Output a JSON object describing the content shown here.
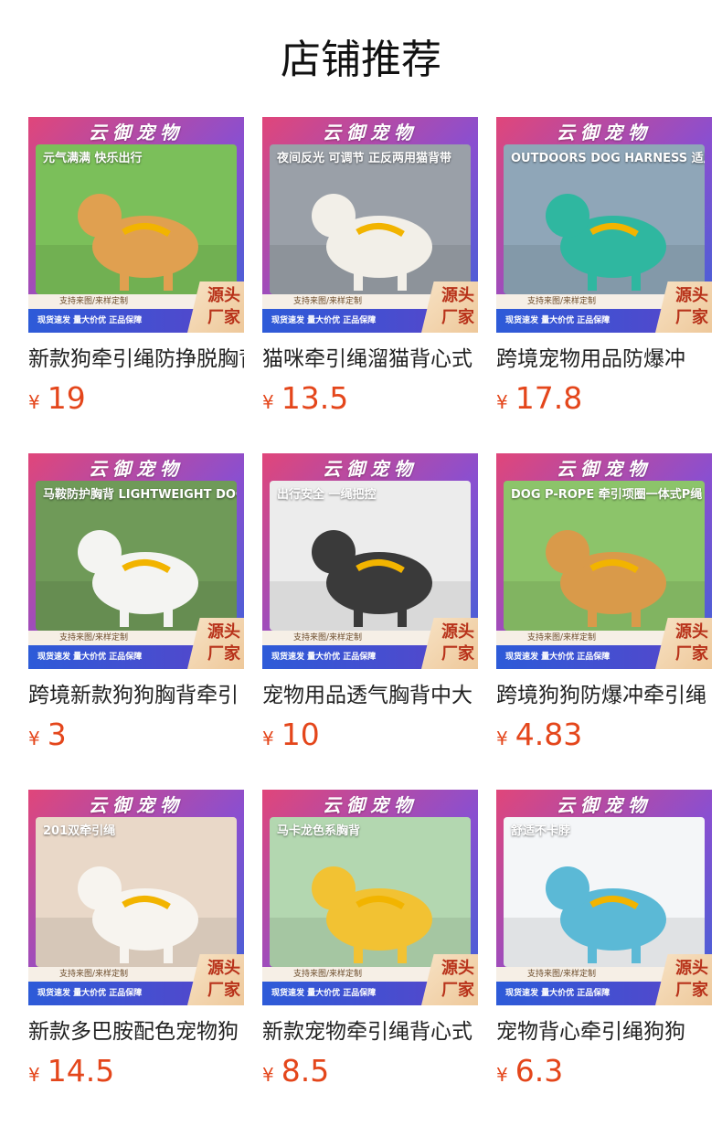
{
  "page_title": "店铺推荐",
  "banner": {
    "brand": "云御宠物",
    "strip1": "支持来图/来样定制",
    "strip2": "现货速发 量大价优 正品保障",
    "factory_line1": "源头",
    "factory_line2": "厂家"
  },
  "currency": "¥",
  "products": [
    {
      "name": "新款狗牵引绳防挣脱胸背",
      "price": "19",
      "caption": "元气满满 快乐出行",
      "bg": "#7bbf5a",
      "subject": "#e0a050"
    },
    {
      "name": "猫咪牵引绳溜猫背心式",
      "price": "13.5",
      "caption": "夜间反光 可调节 正反两用猫背带",
      "bg": "#9aa0a8",
      "subject": "#f2efe8"
    },
    {
      "name": "跨境宠物用品防爆冲",
      "price": "17.8",
      "caption": "OUTDOORS DOG HARNESS 适用于多场景",
      "bg": "#8fa6b8",
      "subject": "#2fb7a0"
    },
    {
      "name": "跨境新款狗狗胸背牵引",
      "price": "3",
      "caption": "马鞍防护胸背 LIGHTWEIGHT DOG HARNESS",
      "bg": "#6f9a58",
      "subject": "#f4f4f2"
    },
    {
      "name": "宠物用品透气胸背中大",
      "price": "10",
      "caption": "出行安全 一绳把控",
      "bg": "#ececec",
      "subject": "#3a3a3a"
    },
    {
      "name": "跨境狗狗防爆冲牵引绳",
      "price": "4.83",
      "caption": "DOG P-ROPE 牵引项圈一体式P绳",
      "bg": "#8cc46a",
      "subject": "#d99a4a"
    },
    {
      "name": "新款多巴胺配色宠物狗",
      "price": "14.5",
      "caption": "201双牵引绳",
      "bg": "#e9d8c8",
      "subject": "#f7f4ef"
    },
    {
      "name": "新款宠物牵引绳背心式",
      "price": "8.5",
      "caption": "马卡龙色系胸背",
      "bg": "#b3d7b0",
      "subject": "#f2c233"
    },
    {
      "name": "宠物背心牵引绳狗狗",
      "price": "6.3",
      "caption": "舒适不卡脖",
      "bg": "#f4f6f8",
      "subject": "#5bb9d6"
    }
  ]
}
